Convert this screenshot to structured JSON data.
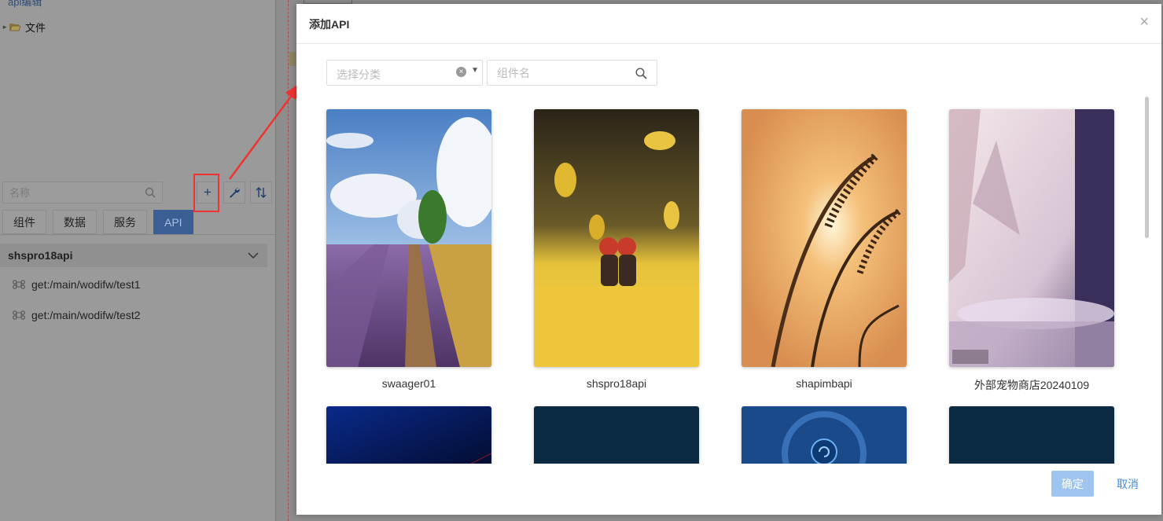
{
  "app": {
    "top_cut_text": "api编辑",
    "tree": {
      "folder_label": "文件"
    },
    "search": {
      "placeholder": "名称"
    },
    "toolbar": {
      "add_label": "+"
    },
    "tabs": [
      {
        "label": "组件"
      },
      {
        "label": "数据"
      },
      {
        "label": "服务"
      },
      {
        "label": "API",
        "active": true
      }
    ],
    "group": {
      "title": "shspro18api",
      "items": [
        {
          "label": "get:/main/wodifw/test1"
        },
        {
          "label": "get:/main/wodifw/test2"
        }
      ]
    }
  },
  "modal": {
    "title": "添加API",
    "close_symbol": "×",
    "category_select": {
      "placeholder": "选择分类"
    },
    "name_search": {
      "placeholder": "组件名"
    },
    "cards": [
      {
        "label": "swaager01",
        "image": "lavender-field"
      },
      {
        "label": "shspro18api",
        "image": "ginkgo-dolls"
      },
      {
        "label": "shapimbapi",
        "image": "grass-sunset"
      },
      {
        "label": "外部宠物商店20240109",
        "image": "misty-forest"
      }
    ],
    "cards_row2": [
      {
        "image": "dark-blue-gradient"
      },
      {
        "image": "dark-tech"
      },
      {
        "image": "blue-tech-ring"
      },
      {
        "image": "dark-tech"
      }
    ],
    "ok_label": "确定",
    "cancel_label": "取消"
  },
  "colors": {
    "accent": "#3c8de0",
    "ok_disabled": "#a0c4f0",
    "annotation_red": "#e33333"
  }
}
